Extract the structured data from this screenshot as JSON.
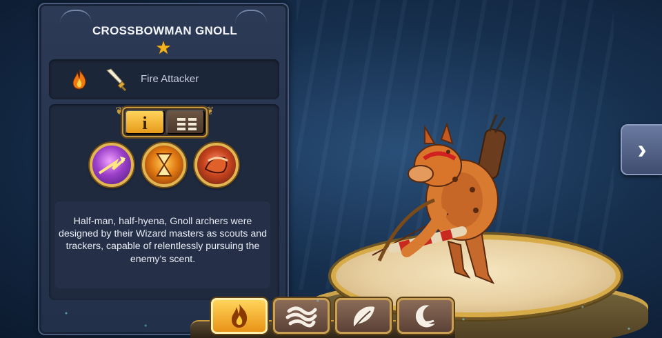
{
  "hero": {
    "name": "CROSSBOWMAN GNOLL",
    "stars": 1,
    "element_icon": "fire-icon",
    "class_icon": "sword-icon",
    "class_label": "Fire Attacker",
    "description": "Half-man, half-hyena, Gnoll archers were designed by their Wizard masters as scouts and trackers, capable of relentlessly pursuing the enemy’s scent."
  },
  "view_toggle": {
    "info_label": "i",
    "selected": "info",
    "options": [
      "info",
      "list"
    ]
  },
  "skills": [
    {
      "icon": "arrow-burst-skill-icon",
      "color": "#9b3fc9"
    },
    {
      "icon": "hourglass-skill-icon",
      "color": "#e27a12"
    },
    {
      "icon": "charging-beast-skill-icon",
      "color": "#c7441d"
    }
  ],
  "navigation": {
    "next_icon": "chevron-right-icon",
    "next_label": "›"
  },
  "element_tabs": [
    {
      "element": "fire",
      "icon": "flame-icon",
      "selected": true
    },
    {
      "element": "water",
      "icon": "wave-icon",
      "selected": false
    },
    {
      "element": "nature",
      "icon": "leaf-icon",
      "selected": false
    },
    {
      "element": "moon",
      "icon": "crescent-moon-icon",
      "selected": false
    }
  ],
  "colors": {
    "accent_gold": "#e1b552",
    "panel": "#2c3a56",
    "selected_tab": "#ffd55a"
  }
}
